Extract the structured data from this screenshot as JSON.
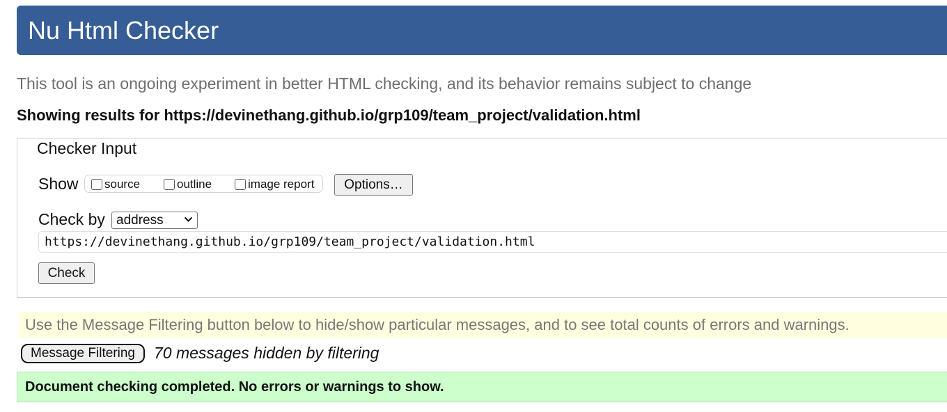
{
  "header": {
    "title": "Nu Html Checker",
    "background_color": "#365d95"
  },
  "intro_text": "This tool is an ongoing experiment in better HTML checking, and its behavior remains subject to change",
  "results_title": "Showing results for https://devinethang.github.io/grp109/team_project/validation.html",
  "checker_input": {
    "legend": "Checker Input",
    "show_label": "Show",
    "show_options": [
      {
        "label": "source",
        "checked": false
      },
      {
        "label": "outline",
        "checked": false
      },
      {
        "label": "image report",
        "checked": false
      }
    ],
    "options_button": "Options…",
    "check_by_label": "Check by",
    "check_by_selected": "address",
    "url_value": "https://devinethang.github.io/grp109/team_project/validation.html",
    "check_button": "Check"
  },
  "filter_note": "Use the Message Filtering button below to hide/show particular messages, and to see total counts of errors and warnings.",
  "message_filtering_button": "Message Filtering",
  "hidden_messages": "70 messages hidden by filtering",
  "success_message": "Document checking completed. No errors or warnings to show.",
  "colors": {
    "info_background": "#ffffe0",
    "success_background": "#ccffcc"
  }
}
